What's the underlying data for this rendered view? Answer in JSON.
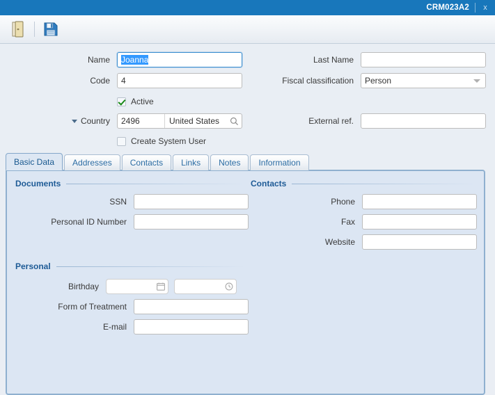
{
  "window": {
    "tab_title": "CRM023A2",
    "close_label": "x"
  },
  "toolbar": {
    "exit_icon": "door-exit-icon",
    "save_icon": "floppy-save-icon"
  },
  "form": {
    "left": {
      "name_label": "Name",
      "name_value": "Joanna",
      "code_label": "Code",
      "code_value": "4",
      "active_label": "Active",
      "active_checked": true,
      "country_label": "Country",
      "country_code": "2496",
      "country_name": "United States",
      "create_system_user_label": "Create System User",
      "create_system_user_checked": false
    },
    "right": {
      "last_name_label": "Last Name",
      "last_name_value": "",
      "fiscal_label": "Fiscal classification",
      "fiscal_value": "Person",
      "external_ref_label": "External ref.",
      "external_ref_value": ""
    }
  },
  "tabs": [
    {
      "label": "Basic Data",
      "active": true
    },
    {
      "label": "Addresses",
      "active": false
    },
    {
      "label": "Contacts",
      "active": false
    },
    {
      "label": "Links",
      "active": false
    },
    {
      "label": "Notes",
      "active": false
    },
    {
      "label": "Information",
      "active": false
    }
  ],
  "panel": {
    "documents": {
      "title": "Documents",
      "ssn_label": "SSN",
      "ssn_value": "",
      "personal_id_label": "Personal ID Number",
      "personal_id_value": ""
    },
    "contacts": {
      "title": "Contacts",
      "phone_label": "Phone",
      "phone_value": "",
      "fax_label": "Fax",
      "fax_value": "",
      "website_label": "Website",
      "website_value": ""
    },
    "personal": {
      "title": "Personal",
      "birthday_label": "Birthday",
      "birthday_date_value": "",
      "birthday_time_value": "",
      "form_of_treatment_label": "Form of Treatment",
      "form_of_treatment_value": "",
      "email_label": "E-mail",
      "email_value": ""
    }
  },
  "colors": {
    "title_bar": "#1877bb",
    "panel_bg": "#dce6f3",
    "panel_border": "#8fb0cf",
    "group_title": "#1e5b96",
    "selection": "#3399ff",
    "check_green": "#1a8a1a"
  }
}
